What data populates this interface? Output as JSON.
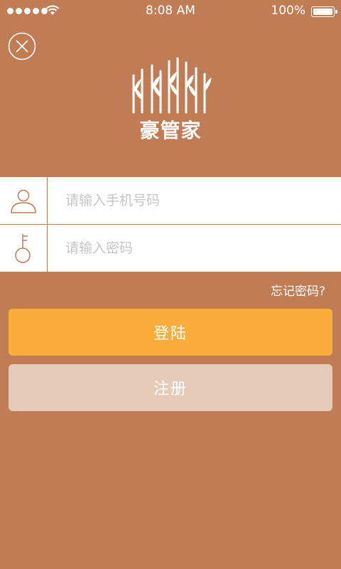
{
  "status_bar": {
    "time": "8:08 AM",
    "battery": "100%",
    "signal_icon": "signal-dots-icon",
    "wifi_icon": "wifi-icon",
    "battery_icon": "battery-icon"
  },
  "close_icon": "close-icon",
  "logo": {
    "text": "豪管家",
    "icon": "wheat-stalks-logo-icon"
  },
  "form": {
    "phone": {
      "value": "",
      "placeholder": "请输入手机号码",
      "icon": "user-icon"
    },
    "password": {
      "value": "",
      "placeholder": "请输入密码",
      "icon": "key-icon"
    }
  },
  "forgot_password": "忘记密码?",
  "buttons": {
    "login": "登陆",
    "register": "注册"
  },
  "colors": {
    "background": "#c07c55",
    "login_button": "#f9ae3c",
    "register_button": "#e6cab8",
    "input_background": "#ffffff",
    "placeholder": "#c4c4c4"
  }
}
